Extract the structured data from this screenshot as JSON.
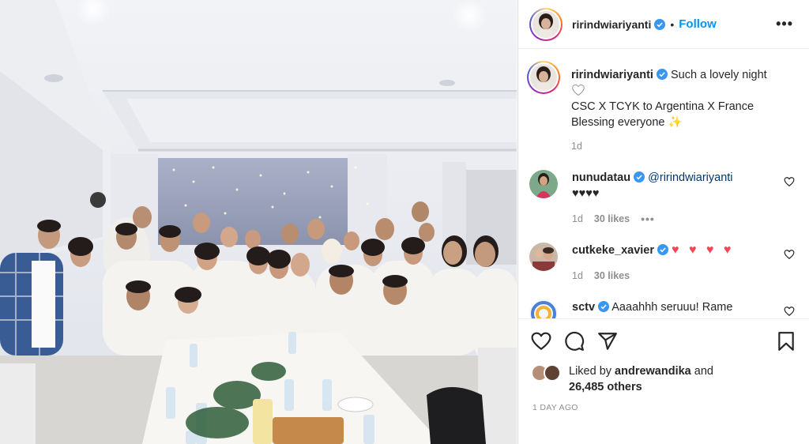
{
  "post": {
    "author": "ririndwiariyanti",
    "follow_label": "Follow",
    "more_label": "•••"
  },
  "caption": {
    "username": "ririndwiariyanti",
    "line1": "Such a lovely night",
    "line2": "CSC X TCYK to Argentina X France",
    "line3": "Blessing everyone ✨",
    "time": "1d"
  },
  "comments": [
    {
      "username": "nunudatau",
      "mention": "@ririndwiariyanti",
      "text": "♥♥♥♥",
      "time": "1d",
      "likes": "30 likes",
      "more": "•••"
    },
    {
      "username": "cutkeke_xavier",
      "text": "♥ ♥ ♥ ♥",
      "time": "1d",
      "likes": "30 likes"
    },
    {
      "username": "sctv",
      "text": "Aaaahhh seruuu! Rame"
    }
  ],
  "likes": {
    "prefix": "Liked by ",
    "user": "andrewandika",
    "suffix": " and",
    "others": "26,485 others"
  },
  "date": "1 DAY AGO",
  "colors": {
    "link": "#0095f6",
    "like_red": "#ed4956",
    "muted": "#8e8e8e"
  },
  "icons": [
    "verified-badge-icon",
    "heart-icon",
    "comment-icon",
    "share-icon",
    "bookmark-icon",
    "more-icon"
  ]
}
